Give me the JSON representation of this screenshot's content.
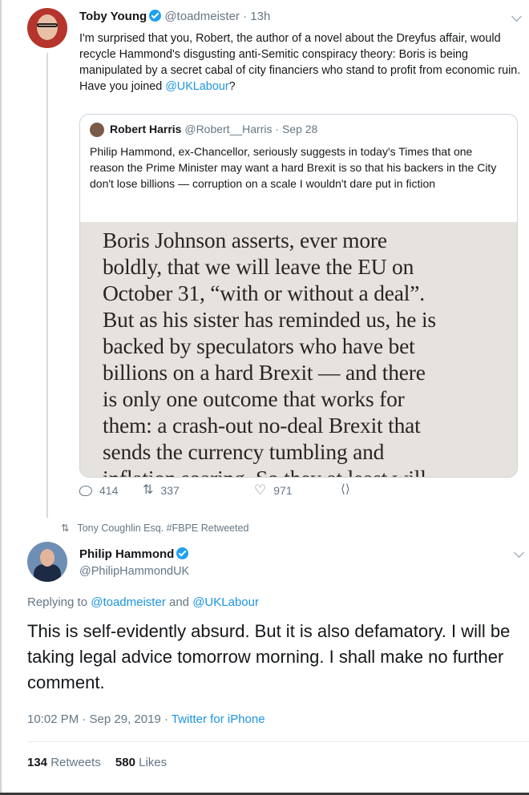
{
  "tweet": {
    "author_name": "Toby Young",
    "author_handle": "@toadmeister",
    "time": "13h",
    "text_before": "I'm surprised that you, Robert, the author of a novel about the Dreyfus affair, would recycle Hammond's disgusting anti-Semitic conspiracy theory: Boris is being manipulated by a secret cabal of city financiers who stand to profit from economic ruin. Have you joined ",
    "mention": "@UKLabour",
    "text_after": "?",
    "quote": {
      "author_name": "Robert Harris",
      "author_handle": "@Robert__Harris",
      "date": "Sep 28",
      "text": "Philip Hammond, ex-Chancellor, seriously suggests in today's Times that one reason the Prime Minister may want a hard Brexit is so that his backers in the City don't lose billions — corruption on a scale I wouldn't dare put in fiction",
      "image_lines": [
        "Boris Johnson asserts, ever more",
        "boldly, that we will leave the EU on",
        "October 31, “with or without a deal”.",
        "But as his sister has reminded us, he is",
        "backed by speculators who have bet",
        "billions on a hard Brexit — and there",
        "is only one outcome that works for",
        "them: a crash-out no-deal Brexit that",
        "sends the currency tumbling and",
        "inflation soaring. So they at least will"
      ]
    },
    "replies": "414",
    "retweets": "337",
    "likes": "971"
  },
  "retweet_note": "Tony Coughlin Esq. #FBPE Retweeted",
  "main": {
    "author_name": "Philip Hammond",
    "author_handle": "@PhilipHammondUK",
    "replying_prefix": "Replying to ",
    "reply_mention_1": "@toadmeister",
    "reply_and": " and ",
    "reply_mention_2": "@UKLabour",
    "text": "This is self-evidently absurd. But it is also defamatory. I will be taking legal advice tomorrow morning. I shall make no further comment.",
    "timestamp": "10:02 PM · Sep 29, 2019 · ",
    "source": "Twitter for iPhone",
    "retweet_count": "134",
    "retweet_label": " Retweets",
    "like_count": "580",
    "like_label": " Likes"
  },
  "colors": {
    "accent": "#1da1f2",
    "link": "#1b95e0",
    "muted": "#657786"
  },
  "icons": [
    "verified-badge-icon",
    "chevron-down-icon",
    "reply-icon",
    "retweet-icon",
    "like-icon",
    "share-icon"
  ]
}
